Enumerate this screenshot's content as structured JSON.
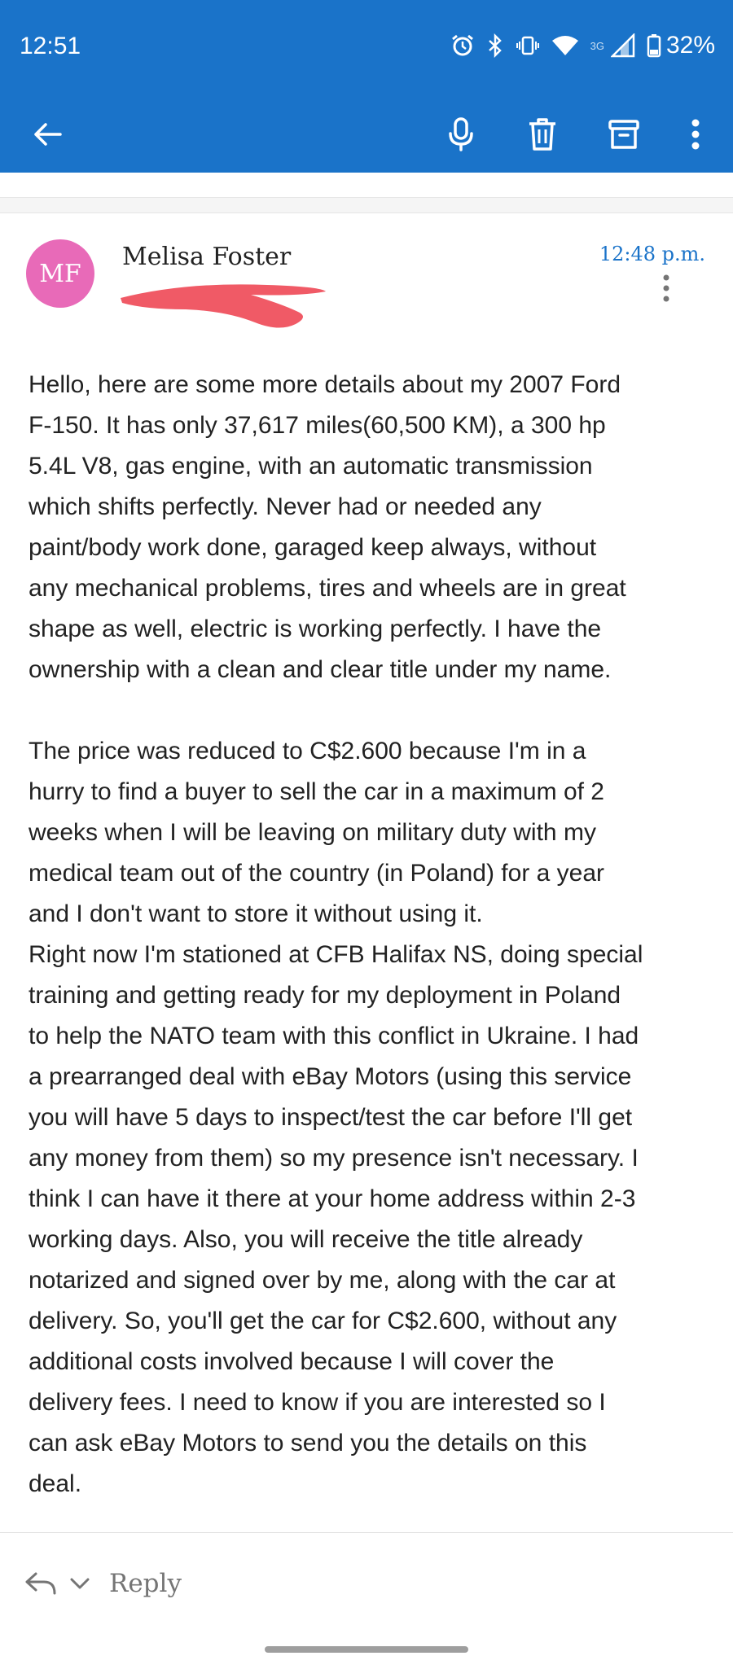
{
  "status_bar": {
    "time": "12:51",
    "network": "3G",
    "battery": "32%",
    "icons": [
      "alarm-icon",
      "bluetooth-icon",
      "vibrate-icon",
      "wifi-icon",
      "signal-icon",
      "battery-icon"
    ]
  },
  "app_bar": {
    "icons": [
      "back-arrow-icon",
      "microphone-icon",
      "trash-icon",
      "archive-icon",
      "more-vert-icon"
    ],
    "color": "#1a73c9"
  },
  "message": {
    "avatar_initials": "MF",
    "avatar_color": "#e86ab8",
    "sender_name": "Melisa Foster",
    "time": "12:48 p.m.",
    "body_lines": [
      "Hello, here are some more details about my 2007 Ford",
      "F-150. It has only 37,617 miles(60,500 KM), a 300 hp",
      "5.4L V8, gas engine, with an automatic transmission",
      "which shifts perfectly. Never had or needed any",
      "paint/body work done, garaged keep always, without",
      "any mechanical problems, tires and wheels are in great",
      "shape as well, electric is working perfectly. I have the",
      "ownership with a clean and clear title under my name.",
      "",
      "The price was reduced to C$2.600 because I'm in a",
      "hurry to find a buyer to sell the car in a maximum of 2",
      "weeks when I will be leaving on military duty with my",
      "medical team out of the country (in Poland)  for a year",
      "and I don't want to store it without using it.",
      "Right now I'm stationed at CFB Halifax NS, doing special",
      "training and getting ready for my deployment in Poland",
      "to help the NATO team with this conflict in Ukraine. I had",
      "a prearranged deal with eBay Motors (using this service",
      "you will have 5 days to inspect/test the car before I'll get",
      "any money from them) so my presence isn't necessary. I",
      "think I can have it there at your home address within 2-3",
      "working days. Also, you will receive the title already",
      "notarized and signed over by me, along with the car at",
      "delivery. So, you'll get the car for C$2.600, without any",
      "additional costs involved because I will cover the",
      "delivery fees. I need to know if you are interested so I",
      "can ask eBay Motors to send you the details on this",
      "deal."
    ]
  },
  "reply_bar": {
    "label": "Reply",
    "icons": [
      "reply-icon",
      "chevron-down-icon"
    ]
  }
}
